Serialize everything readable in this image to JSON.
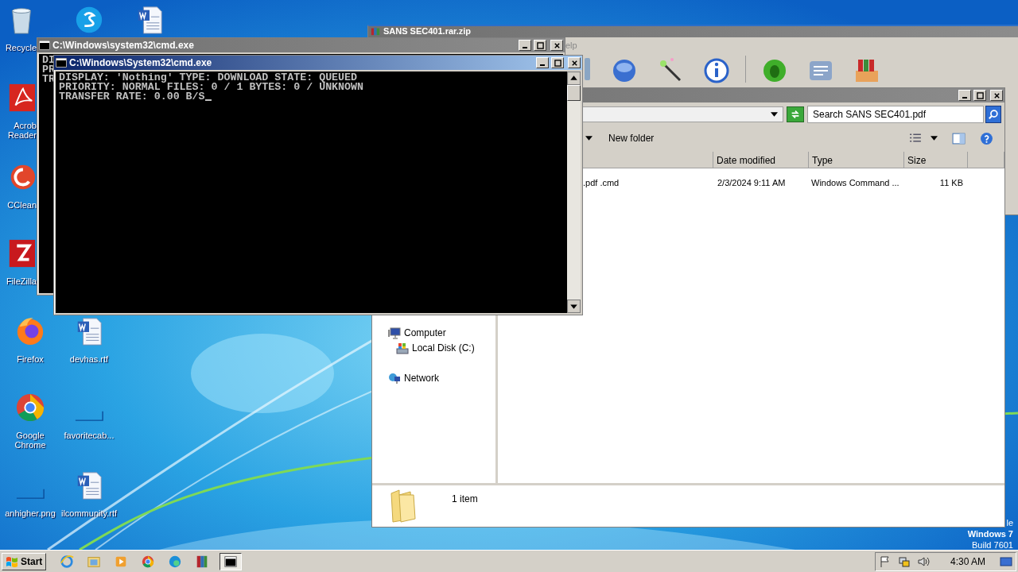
{
  "desktop": {
    "icons": [
      {
        "kind": "recycle",
        "label": "Recycle"
      },
      {
        "kind": "skype"
      },
      {
        "kind": "word"
      },
      {
        "kind": "acrobat",
        "label": "Acrob Reader"
      },
      {
        "kind": "ccleaner",
        "label": "CClean"
      },
      {
        "kind": "filezilla",
        "label": "FileZilla"
      },
      {
        "kind": "firefox",
        "label": "Firefox"
      },
      {
        "kind": "word",
        "label": "devhas.rtf"
      },
      {
        "kind": "chrome",
        "label": "Google Chrome"
      },
      {
        "kind": "blank",
        "label": "favoritecab..."
      },
      {
        "kind": "blank",
        "label": "anhigher.png"
      },
      {
        "kind": "word",
        "label": "ilcommunity.rtf"
      }
    ],
    "os_info": {
      "edition": "le",
      "name": "Windows 7",
      "build": "Build 7601"
    }
  },
  "archive_window": {
    "title": "SANS SEC401.rar.zip",
    "active": false,
    "menu_fragment": "elp"
  },
  "explorer": {
    "active": false,
    "search": {
      "placeholder": "Search SANS SEC401.pdf"
    },
    "new_folder": "New folder",
    "columns": [
      "Date modified",
      "Type",
      "Size"
    ],
    "rows": [
      {
        "name": ".pdf .cmd",
        "date_modified": "2/3/2024 9:11 AM",
        "type": "Windows Command ...",
        "size": "11 KB"
      }
    ],
    "nav": [
      {
        "kind": "computer",
        "label": "Computer",
        "children": [
          {
            "kind": "drive",
            "label": "Local Disk (C:)"
          }
        ]
      },
      {
        "kind": "network",
        "label": "Network"
      }
    ],
    "status": "1 item"
  },
  "console_back": {
    "title": "C:\\Windows\\system32\\cmd.exe",
    "active": false,
    "lines": [
      "DI",
      "PR",
      "TR"
    ]
  },
  "console_front": {
    "title": "C:\\Windows\\System32\\cmd.exe",
    "active": true,
    "lines": [
      "DISPLAY: 'Nothing' TYPE: DOWNLOAD STATE: QUEUED",
      "PRIORITY: NORMAL FILES: 0 / 1 BYTES: 0 / UNKNOWN",
      "TRANSFER RATE: 0.00 B/S"
    ]
  },
  "taskbar": {
    "start": "Start",
    "apps": [
      {
        "kind": "ie",
        "selected": false
      },
      {
        "kind": "folder",
        "selected": false
      },
      {
        "kind": "media",
        "selected": false
      },
      {
        "kind": "chrome",
        "selected": false
      },
      {
        "kind": "edge",
        "selected": false
      },
      {
        "kind": "archive",
        "selected": false
      },
      {
        "kind": "cmd",
        "selected": true
      }
    ],
    "clock": "4:30 AM"
  }
}
